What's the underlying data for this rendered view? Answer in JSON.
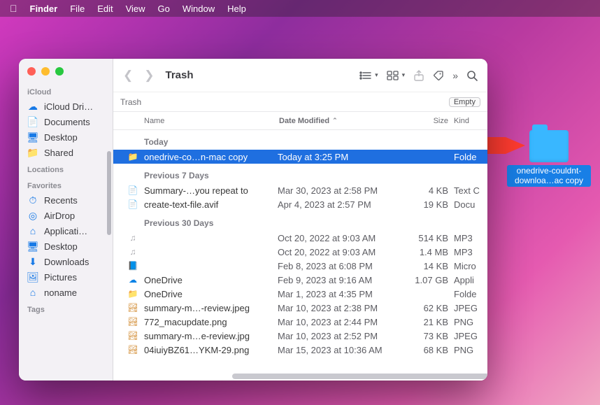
{
  "menubar": {
    "appname": "Finder",
    "items": [
      "File",
      "Edit",
      "View",
      "Go",
      "Window",
      "Help"
    ]
  },
  "desktop_icon": {
    "label": "onedrive-couldnt-downloa…ac copy"
  },
  "finder": {
    "title": "Trash",
    "path_label": "Trash",
    "empty_button": "Empty",
    "sidebar": {
      "sections": [
        {
          "header": "iCloud",
          "items": [
            {
              "icon": "cloud",
              "label": "iCloud Dri…"
            },
            {
              "icon": "doc",
              "label": "Documents"
            },
            {
              "icon": "desktop",
              "label": "Desktop"
            },
            {
              "icon": "folder",
              "label": "Shared"
            }
          ]
        },
        {
          "header": "Locations",
          "items": []
        },
        {
          "header": "Favorites",
          "items": [
            {
              "icon": "clock",
              "label": "Recents"
            },
            {
              "icon": "airdrop",
              "label": "AirDrop"
            },
            {
              "icon": "app",
              "label": "Applicati…"
            },
            {
              "icon": "desktop",
              "label": "Desktop"
            },
            {
              "icon": "download",
              "label": "Downloads"
            },
            {
              "icon": "pic",
              "label": "Pictures"
            },
            {
              "icon": "home",
              "label": "noname"
            }
          ]
        },
        {
          "header": "Tags",
          "items": []
        }
      ]
    },
    "columns": {
      "name": "Name",
      "date": "Date Modified",
      "size": "Size",
      "kind": "Kind"
    },
    "groups": [
      {
        "label": "Today",
        "rows": [
          {
            "icon": "folder",
            "name": "onedrive-co…n-mac copy",
            "date": "Today at 3:25 PM",
            "size": "",
            "kind": "Folde",
            "selected": true
          }
        ]
      },
      {
        "label": "Previous 7 Days",
        "rows": [
          {
            "icon": "txt",
            "name": "Summary-…you repeat to",
            "date": "Mar 30, 2023 at 2:58 PM",
            "size": "4 KB",
            "kind": "Text C"
          },
          {
            "icon": "txt",
            "name": "create-text-file.avif",
            "date": "Apr 4, 2023 at 2:57 PM",
            "size": "19 KB",
            "kind": "Docu"
          }
        ]
      },
      {
        "label": "Previous 30 Days",
        "rows": [
          {
            "icon": "mp3",
            "name": "",
            "date": "Oct 20, 2022 at 9:03 AM",
            "size": "514 KB",
            "kind": "MP3"
          },
          {
            "icon": "mp3",
            "name": "",
            "date": "Oct 20, 2022 at 9:03 AM",
            "size": "1.4 MB",
            "kind": "MP3"
          },
          {
            "icon": "word",
            "name": "",
            "date": "Feb 8, 2023 at 6:08 PM",
            "size": "14 KB",
            "kind": "Micro"
          },
          {
            "icon": "cloud",
            "name": "OneDrive",
            "date": "Feb 9, 2023 at 9:16 AM",
            "size": "1.07 GB",
            "kind": "Appli"
          },
          {
            "icon": "folder",
            "name": "OneDrive",
            "date": "Mar 1, 2023 at 4:35 PM",
            "size": "",
            "kind": "Folde"
          },
          {
            "icon": "jpeg",
            "name": "summary-m…-review.jpeg",
            "date": "Mar 10, 2023 at 2:38 PM",
            "size": "62 KB",
            "kind": "JPEG"
          },
          {
            "icon": "png",
            "name": "772_macupdate.png",
            "date": "Mar 10, 2023 at 2:44 PM",
            "size": "21 KB",
            "kind": "PNG"
          },
          {
            "icon": "jpeg",
            "name": "summary-m…e-review.jpg",
            "date": "Mar 10, 2023 at 2:52 PM",
            "size": "73 KB",
            "kind": "JPEG"
          },
          {
            "icon": "png",
            "name": "04iuiyBZ61…YKM-29.png",
            "date": "Mar 15, 2023 at 10:36 AM",
            "size": "68 KB",
            "kind": "PNG"
          }
        ]
      }
    ]
  }
}
